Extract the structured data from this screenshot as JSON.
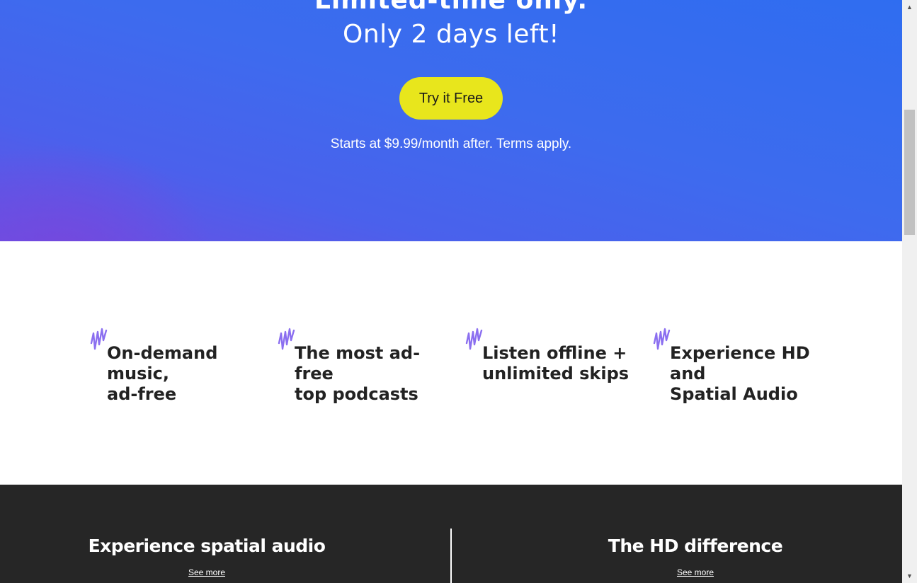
{
  "hero": {
    "limited_text": "Limited-time only.",
    "days_prefix": "Only",
    "days_count": "2",
    "days_suffix": "days left!",
    "cta_label": "Try it Free",
    "terms": "Starts at $9.99/month after. Terms apply."
  },
  "features": [
    {
      "text": "On-demand\nmusic,\nad-free"
    },
    {
      "text": "The most ad-\nfree\ntop podcasts"
    },
    {
      "text": "Listen offline +\nunlimited skips"
    },
    {
      "text": "Experience HD\nand\nSpatial Audio"
    }
  ],
  "dark_section": {
    "left": {
      "title": "Experience spatial audio",
      "link": "See more"
    },
    "right": {
      "title": "The HD difference",
      "link": "See more"
    }
  },
  "colors": {
    "hero_blue": "#3d6bee",
    "cta_yellow": "#e8e61c",
    "wave_purple": "#8b6ff0",
    "dark_bg": "#262626"
  },
  "icons": {
    "feature": "sound-wave-icon",
    "scroll_up": "arrow-up-icon",
    "scroll_down": "arrow-down-icon"
  }
}
